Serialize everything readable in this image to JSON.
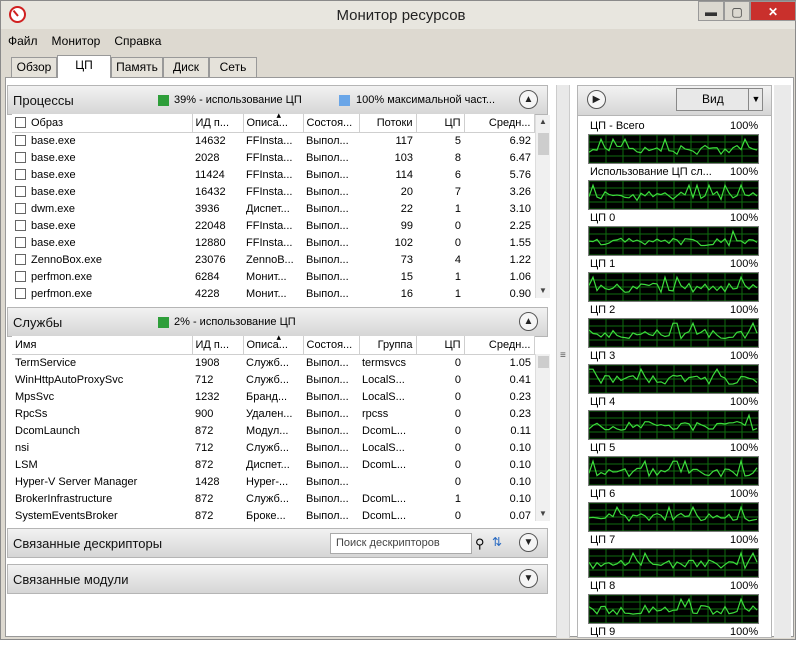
{
  "window": {
    "title": "Монитор ресурсов",
    "controls": {
      "minimize": "▬",
      "maximize": "▢",
      "close": "✕"
    }
  },
  "menu": [
    "Файл",
    "Монитор",
    "Справка"
  ],
  "tabs": [
    "Обзор",
    "ЦП",
    "Память",
    "Диск",
    "Сеть"
  ],
  "active_tab": "ЦП",
  "processes": {
    "title": "Процессы",
    "legend1": {
      "text": "39% - использование ЦП",
      "color": "#2e9e3a"
    },
    "legend2": {
      "text": "100% максимальной част...",
      "color": "#6aa6e8"
    },
    "columns": [
      "Образ",
      "ИД п...",
      "Описа...",
      "Состоя...",
      "Потоки",
      "ЦП",
      "Средн..."
    ],
    "rows": [
      [
        "base.exe",
        "14632",
        "FFInsta...",
        "Выпол...",
        "117",
        "5",
        "6.92"
      ],
      [
        "base.exe",
        "2028",
        "FFInsta...",
        "Выпол...",
        "103",
        "8",
        "6.47"
      ],
      [
        "base.exe",
        "11424",
        "FFInsta...",
        "Выпол...",
        "114",
        "6",
        "5.76"
      ],
      [
        "base.exe",
        "16432",
        "FFInsta...",
        "Выпол...",
        "20",
        "7",
        "3.26"
      ],
      [
        "dwm.exe",
        "3936",
        "Диспет...",
        "Выпол...",
        "22",
        "1",
        "3.10"
      ],
      [
        "base.exe",
        "22048",
        "FFInsta...",
        "Выпол...",
        "99",
        "0",
        "2.25"
      ],
      [
        "base.exe",
        "12880",
        "FFInsta...",
        "Выпол...",
        "102",
        "0",
        "1.55"
      ],
      [
        "ZennoBox.exe",
        "23076",
        "ZennoB...",
        "Выпол...",
        "73",
        "4",
        "1.22"
      ],
      [
        "perfmon.exe",
        "6284",
        "Монит...",
        "Выпол...",
        "15",
        "1",
        "1.06"
      ],
      [
        "perfmon.exe",
        "4228",
        "Монит...",
        "Выпол...",
        "16",
        "1",
        "0.90"
      ]
    ]
  },
  "services": {
    "title": "Службы",
    "legend1": {
      "text": "2% - использование ЦП",
      "color": "#2e9e3a"
    },
    "columns": [
      "Имя",
      "ИД п...",
      "Описа...",
      "Состоя...",
      "Группа",
      "ЦП",
      "Средн..."
    ],
    "rows": [
      [
        "TermService",
        "1908",
        "Служб...",
        "Выпол...",
        "termsvcs",
        "0",
        "1.05"
      ],
      [
        "WinHttpAutoProxySvc",
        "712",
        "Служб...",
        "Выпол...",
        "LocalS...",
        "0",
        "0.41"
      ],
      [
        "MpsSvc",
        "1232",
        "Бранд...",
        "Выпол...",
        "LocalS...",
        "0",
        "0.23"
      ],
      [
        "RpcSs",
        "900",
        "Удален...",
        "Выпол...",
        "rpcss",
        "0",
        "0.23"
      ],
      [
        "DcomLaunch",
        "872",
        "Модул...",
        "Выпол...",
        "DcomL...",
        "0",
        "0.11"
      ],
      [
        "nsi",
        "712",
        "Служб...",
        "Выпол...",
        "LocalS...",
        "0",
        "0.10"
      ],
      [
        "LSM",
        "872",
        "Диспет...",
        "Выпол...",
        "DcomL...",
        "0",
        "0.10"
      ],
      [
        "Hyper-V Server Manager",
        "1428",
        "Hyper-...",
        "Выпол...",
        "",
        "0",
        "0.10"
      ],
      [
        "BrokerInfrastructure",
        "872",
        "Служб...",
        "Выпол...",
        "DcomL...",
        "1",
        "0.10"
      ],
      [
        "SystemEventsBroker",
        "872",
        "Броке...",
        "Выпол...",
        "DcomL...",
        "0",
        "0.07"
      ]
    ]
  },
  "handles": {
    "title": "Связанные дескрипторы",
    "search_placeholder": "Поиск дескрипторов"
  },
  "modules": {
    "title": "Связанные модули"
  },
  "right": {
    "view_label": "Вид",
    "graphs": [
      {
        "label": "ЦП - Всего",
        "pct": "100%"
      },
      {
        "label": "Использование ЦП сл...",
        "pct": "100%"
      },
      {
        "label": "ЦП 0",
        "pct": "100%"
      },
      {
        "label": "ЦП 1",
        "pct": "100%"
      },
      {
        "label": "ЦП 2",
        "pct": "100%"
      },
      {
        "label": "ЦП 3",
        "pct": "100%"
      },
      {
        "label": "ЦП 4",
        "pct": "100%"
      },
      {
        "label": "ЦП 5",
        "pct": "100%"
      },
      {
        "label": "ЦП 6",
        "pct": "100%"
      },
      {
        "label": "ЦП 7",
        "pct": "100%"
      },
      {
        "label": "ЦП 8",
        "pct": "100%"
      },
      {
        "label": "ЦП 9",
        "pct": "100%"
      }
    ]
  },
  "colors": {
    "graph_line": "#3cdc3c",
    "graph_grid": "#0f6b0f"
  }
}
